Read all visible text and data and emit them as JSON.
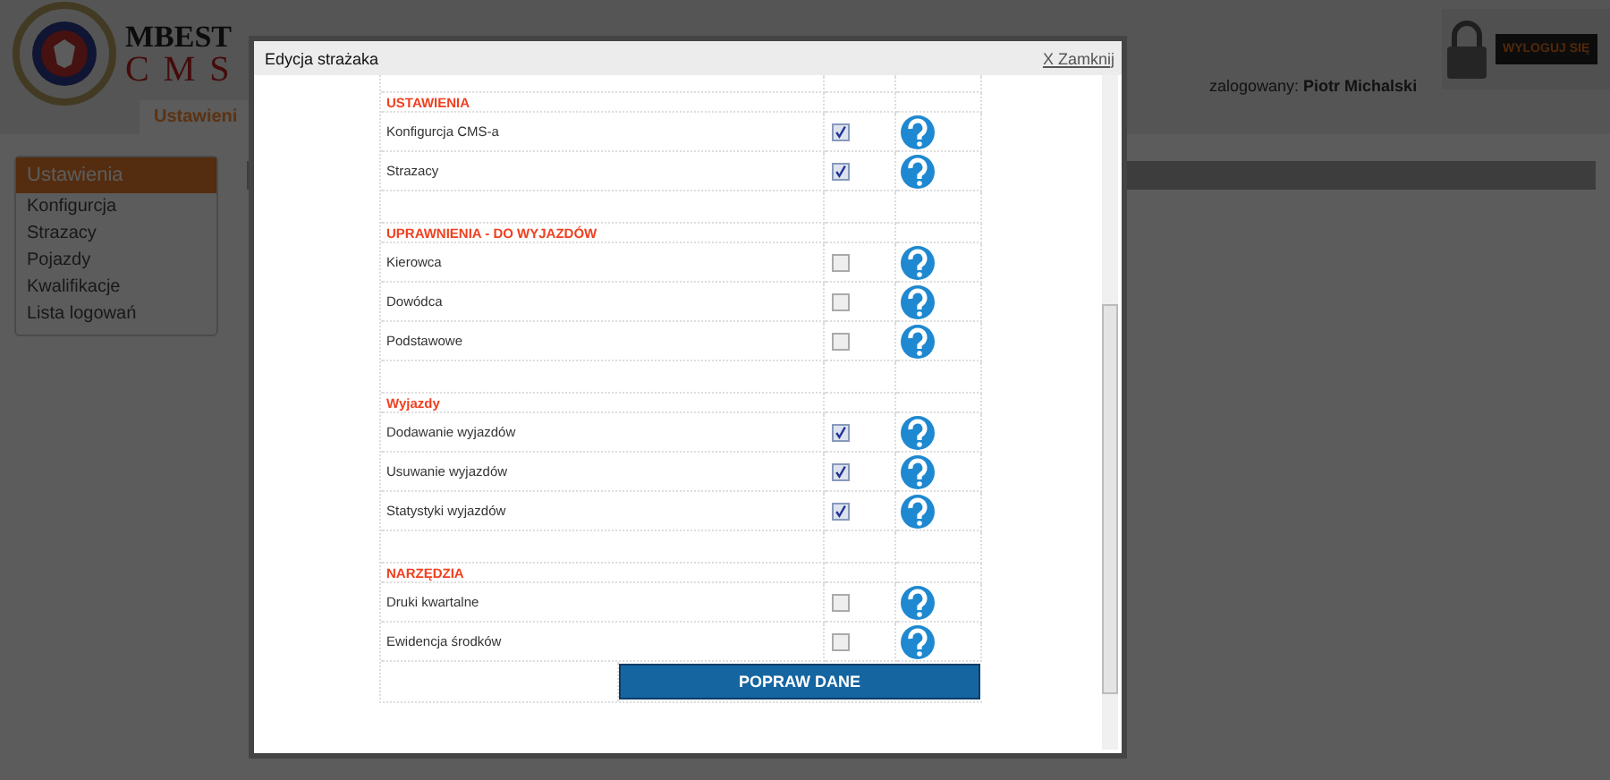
{
  "logo": {
    "top": "MBEST",
    "bottom": "CMS"
  },
  "top_tab": {
    "label": "Ustawieni",
    "selected": true
  },
  "user": {
    "prefix": "zalogowany:",
    "name": "Piotr Michalski"
  },
  "logout_button": {
    "label": "WYLOGUJ SIĘ"
  },
  "sidebar": {
    "title": "Ustawienia",
    "items": [
      "Konfigurcja",
      "Strazacy",
      "Pojazdy",
      "Kwalifikacje",
      "Lista logowań"
    ]
  },
  "dialog": {
    "title": "Edycja strażaka",
    "close": "X Zamknij",
    "sections": [
      {
        "title": "USTAWIENIA",
        "items": [
          {
            "label": "Konfigurcja CMS-a",
            "checked": true
          },
          {
            "label": "Strazacy",
            "checked": true
          }
        ]
      },
      {
        "title": "UPRAWNIENIA - DO WYJAZDÓW",
        "items": [
          {
            "label": "Kierowca",
            "checked": false
          },
          {
            "label": "Dowódca",
            "checked": false
          },
          {
            "label": "Podstawowe",
            "checked": false
          }
        ]
      },
      {
        "title": "Wyjazdy",
        "items": [
          {
            "label": "Dodawanie wyjazdów",
            "checked": true
          },
          {
            "label": "Usuwanie wyjazdów",
            "checked": true
          },
          {
            "label": "Statystyki wyjazdów",
            "checked": true
          }
        ]
      },
      {
        "title": "NARZĘDZIA",
        "items": [
          {
            "label": "Druki kwartalne",
            "checked": false
          },
          {
            "label": "Ewidencja środków",
            "checked": false
          }
        ]
      }
    ],
    "submit": "POPRAW DANE"
  }
}
